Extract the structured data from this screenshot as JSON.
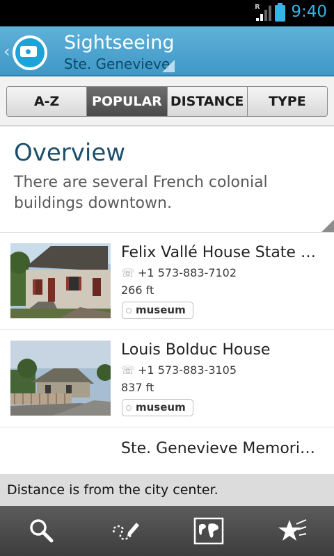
{
  "status_bar": {
    "time": "9:40",
    "signal_label": "R"
  },
  "action_bar": {
    "title": "Sightseeing",
    "subtitle": "Ste. Genevieve"
  },
  "tabs": [
    {
      "label": "A-Z",
      "active": false
    },
    {
      "label": "POPULAR",
      "active": true
    },
    {
      "label": "DISTANCE",
      "active": false
    },
    {
      "label": "TYPE",
      "active": false
    }
  ],
  "overview": {
    "heading": "Overview",
    "text": "There are several French colonial buildings downtown."
  },
  "items": [
    {
      "title": "Felix Vallé House State Historic Site",
      "phone": "+1 573-883-7102",
      "distance": "266 ft",
      "tag": "museum"
    },
    {
      "title": "Louis Bolduc House",
      "phone": "+1 573-883-3105",
      "distance": "837 ft",
      "tag": "museum"
    },
    {
      "title": "Ste. Genevieve Memorial Cemetery"
    }
  ],
  "note": "Distance is from the city center.",
  "bottom_bar": {
    "icons": [
      "search-icon",
      "draw-route-icon",
      "world-map-icon",
      "favorites-star-icon"
    ]
  },
  "colors": {
    "accent": "#33b5e5",
    "action_bar": "#4ea6d0",
    "heading": "#1d4f6b"
  }
}
